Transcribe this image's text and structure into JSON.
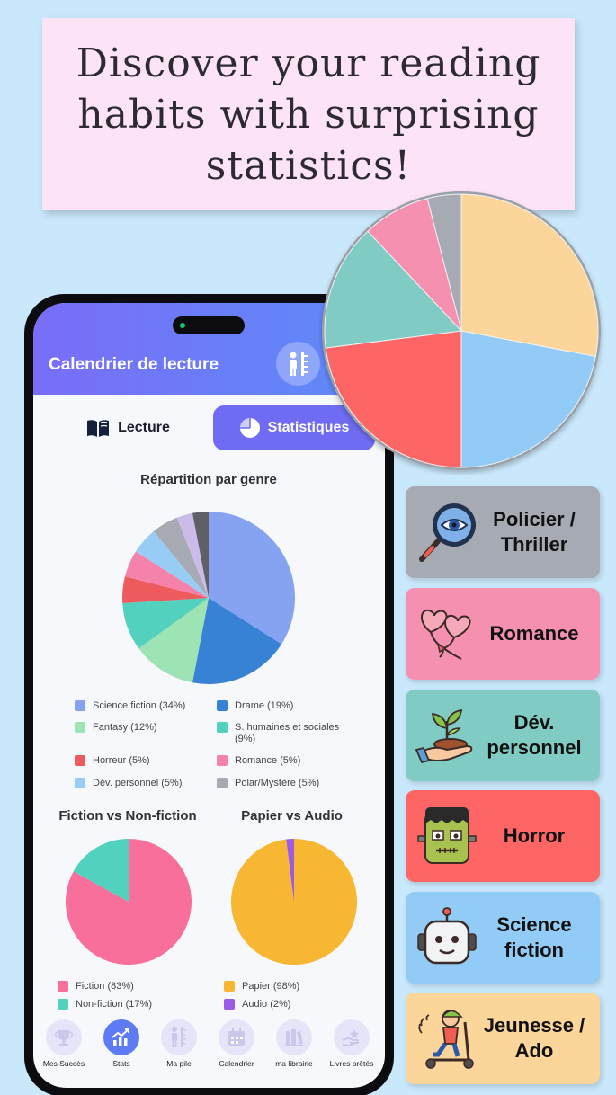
{
  "headline": "Discover your reading habits with surprising statistics!",
  "app": {
    "title": "Calendrier de lecture",
    "tabs": [
      {
        "label": "Lecture",
        "icon": "book-icon"
      },
      {
        "label": "Statistiques",
        "icon": "pie-chart-icon"
      }
    ]
  },
  "colors": {
    "header_from": "#7a6df8",
    "header_to": "#5c8cf8",
    "active_tab": "#6f6cf3"
  },
  "chart_data": [
    {
      "type": "pie",
      "title": "Répartition par genre",
      "categories": [
        "Science fiction",
        "Drame",
        "Fantasy",
        "S. humaines et sociales",
        "Horreur",
        "Romance",
        "Dév. personnel",
        "Polar/Mystère",
        "",
        ""
      ],
      "values": [
        34,
        19,
        12,
        9,
        5,
        5,
        5,
        5,
        3,
        3
      ],
      "colors": [
        "#85a3f0",
        "#3782d4",
        "#9ee3b4",
        "#52d1bf",
        "#ee5b5d",
        "#f582aa",
        "#97cdf4",
        "#a7aab3",
        "#cbbbe8",
        "#5f5f66"
      ],
      "legend": [
        {
          "label": "Science fiction (34%)",
          "color": "#85a3f0"
        },
        {
          "label": "Drame (19%)",
          "color": "#3782d4"
        },
        {
          "label": "Fantasy (12%)",
          "color": "#9ee3b4"
        },
        {
          "label": "S. humaines et sociales (9%)",
          "color": "#52d1bf"
        },
        {
          "label": "Horreur (5%)",
          "color": "#ee5b5d"
        },
        {
          "label": "Romance (5%)",
          "color": "#f582aa"
        },
        {
          "label": "Dév. personnel (5%)",
          "color": "#97cdf4"
        },
        {
          "label": "Polar/Mystère (5%)",
          "color": "#a7aab3"
        }
      ]
    },
    {
      "type": "pie",
      "title": "Fiction vs Non-fiction",
      "categories": [
        "Fiction",
        "Non-fiction"
      ],
      "values": [
        83,
        17
      ],
      "colors": [
        "#f76f9a",
        "#52d1bf"
      ],
      "legend": [
        {
          "label": "Fiction (83%)",
          "color": "#f76f9a"
        },
        {
          "label": "Non-fiction (17%)",
          "color": "#52d1bf"
        }
      ]
    },
    {
      "type": "pie",
      "title": "Papier vs Audio",
      "categories": [
        "Papier",
        "Audio"
      ],
      "values": [
        98,
        2
      ],
      "colors": [
        "#f7b733",
        "#9a5ce6"
      ],
      "legend": [
        {
          "label": "Papier (98%)",
          "color": "#f7b733"
        },
        {
          "label": "Audio (2%)",
          "color": "#9a5ce6"
        }
      ]
    },
    {
      "type": "pie",
      "title": "",
      "categories": [
        "Jeunesse / Ado",
        "Science fiction",
        "Horror",
        "Dév. personnel",
        "Romance",
        "Policier / Thriller"
      ],
      "values": [
        28,
        22,
        23,
        15,
        8,
        4
      ],
      "colors": [
        "#fcd59b",
        "#92cbf6",
        "#fd6665",
        "#80cbc4",
        "#f690b1",
        "#a6aab3"
      ]
    }
  ],
  "nav": [
    {
      "label": "Mes Succès",
      "icon": "trophy-icon"
    },
    {
      "label": "Stats",
      "icon": "chart-trend-icon",
      "active": true
    },
    {
      "label": "Ma pile",
      "icon": "book-stack-icon"
    },
    {
      "label": "Calendrier",
      "icon": "calendar-icon"
    },
    {
      "label": "ma librairie",
      "icon": "library-icon"
    },
    {
      "label": "Livres prêtés",
      "icon": "lend-icon"
    }
  ],
  "genres": [
    {
      "label": "Policier / Thriller",
      "color": "#a6aab3",
      "icon": "magnifier-eye-icon"
    },
    {
      "label": "Romance",
      "color": "#f690b1",
      "icon": "heart-balloons-icon"
    },
    {
      "label": "Dév. personnel",
      "color": "#80cbc4",
      "icon": "plant-hand-icon"
    },
    {
      "label": "Horror",
      "color": "#fd6665",
      "icon": "frankenstein-icon"
    },
    {
      "label": "Science fiction",
      "color": "#92cbf6",
      "icon": "robot-icon"
    },
    {
      "label": "Jeunesse / Ado",
      "color": "#fcd59b",
      "icon": "kid-scooter-icon"
    }
  ]
}
